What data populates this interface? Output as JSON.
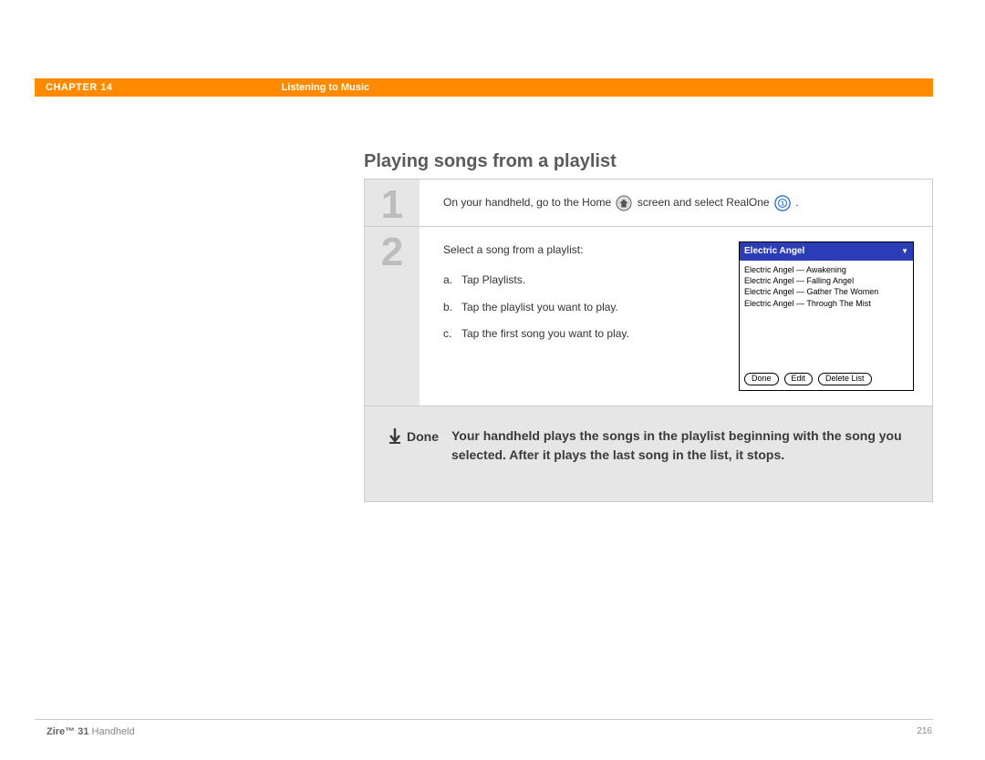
{
  "header": {
    "chapter": "CHAPTER 14",
    "section": "Listening to Music"
  },
  "title": "Playing songs from a playlist",
  "steps": {
    "one": {
      "num": "1",
      "text_before_home": "On your handheld, go to the Home",
      "text_mid": "screen and select RealOne",
      "text_end": "."
    },
    "two": {
      "num": "2",
      "intro": "Select a song from a playlist:",
      "a_letter": "a.",
      "a_text": "Tap Playlists.",
      "b_letter": "b.",
      "b_text": "Tap the playlist you want to play.",
      "c_letter": "c.",
      "c_text": "Tap the first song you want to play."
    }
  },
  "playlist_screenshot": {
    "header": "Electric Angel",
    "items": [
      "Electric Angel — Awakening",
      "Electric Angel — Falling Angel",
      "Electric Angel — Gather The Women",
      "Electric Angel — Through The Mist"
    ],
    "buttons": {
      "done": "Done",
      "edit": "Edit",
      "delete": "Delete List"
    }
  },
  "done": {
    "label": "Done",
    "text": "Your handheld plays the songs in the playlist beginning with the song you selected. After it plays the last song in the list, it stops."
  },
  "footer": {
    "product_bold": "Zire™ 31",
    "product_rest": " Handheld",
    "page": "216"
  }
}
